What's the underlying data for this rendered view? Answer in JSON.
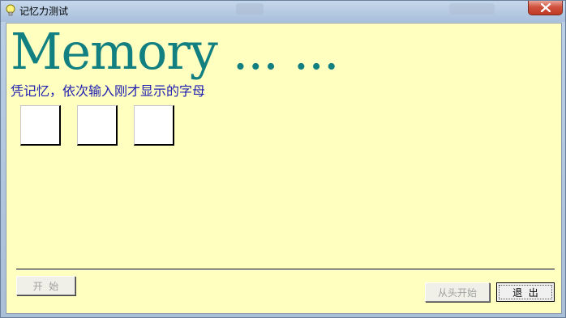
{
  "window": {
    "title": "记忆力测试",
    "icon": "lightbulb-icon",
    "close_icon": "close-icon"
  },
  "main": {
    "big_title": "Memory ... ...",
    "instruction": "凭记忆，依次输入刚才显示的字母",
    "letter_boxes": [
      "",
      "",
      ""
    ]
  },
  "buttons": {
    "start_label": "开  始",
    "restart_label": "从头开始",
    "exit_label": "退  出"
  },
  "colors": {
    "client_bg": "#ffffc0",
    "title_color": "#128080",
    "instruction_color": "#2020b0",
    "close_button": "#c03a25"
  }
}
